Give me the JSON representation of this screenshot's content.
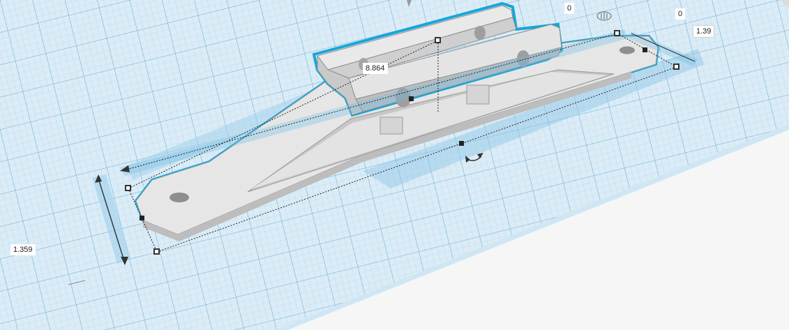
{
  "app": "3D design workplane",
  "dimensions": {
    "length": "8.864",
    "width": "1.39",
    "height": "1.359",
    "offset_x": "0",
    "offset_y": "0"
  },
  "colors": {
    "workplane": "#dbecf6",
    "grid_minor": "#a9cfe6",
    "grid_major": "#6fb0d7",
    "selection_outline": "#16a6d9",
    "part_light": "#e9e9e9",
    "part_mid": "#d4d4d4",
    "part_dark": "#a9a9a9",
    "background": "#ffffff"
  },
  "icons": {
    "rotate": "rotate-arrow-icon",
    "height_arrow": "height-arrow-icon",
    "ruler": "ruler-icon"
  }
}
